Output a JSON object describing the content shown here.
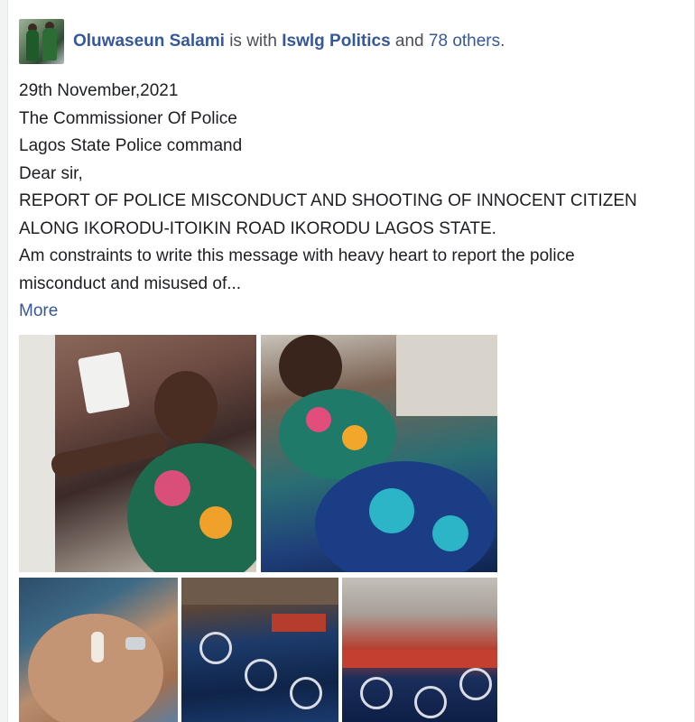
{
  "post": {
    "author": "Oluwaseun Salami",
    "with_word": "is with",
    "tagged": "Iswlg Politics",
    "and_word": "and",
    "others": "78 others",
    "period": "."
  },
  "message": {
    "lines": [
      "29th November,2021",
      "The Commissioner Of Police",
      "Lagos State Police command",
      "Dear sir,",
      "REPORT OF POLICE MISCONDUCT AND SHOOTING OF INNOCENT CITIZEN",
      "ALONG IKORODU-ITOIKIN  ROAD IKORODU LAGOS STATE.",
      "Am constraints to write this message with heavy heart to report the police",
      "misconduct and misused of..."
    ],
    "more_label": "More"
  },
  "colors": {
    "link": "#365899",
    "text": "#1c1e21",
    "muted": "#4b4f56"
  }
}
